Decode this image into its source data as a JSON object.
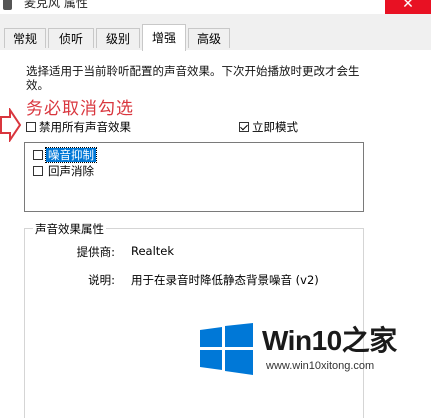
{
  "window": {
    "title": "麦克风 属性",
    "close_glyph": "✕"
  },
  "tabs": [
    {
      "label": "常规",
      "active": false
    },
    {
      "label": "侦听",
      "active": false
    },
    {
      "label": "级别",
      "active": false
    },
    {
      "label": "增强",
      "active": true
    },
    {
      "label": "高级",
      "active": false
    }
  ],
  "enhancements": {
    "description": "选择适用于当前聆听配置的声音效果。下次开始播放时更改才会生效。",
    "annotation": "务必取消勾选",
    "disable_all": {
      "label": "禁用所有声音效果",
      "checked": false
    },
    "immediate_mode": {
      "label": "立即模式",
      "checked": true
    },
    "effects": [
      {
        "label": "噪音抑制",
        "checked": false,
        "selected": true
      },
      {
        "label": "回声消除",
        "checked": false,
        "selected": false
      }
    ],
    "properties": {
      "title": "声音效果属性",
      "provider_label": "提供商:",
      "provider_value": "Realtek",
      "description_label": "说明:",
      "description_value": "用于在录音时降低静态背景噪音 (v2)"
    }
  },
  "watermark": {
    "brand_prefix": "Win10",
    "brand_suffix": "之家",
    "url": "www.win10xitong.com"
  },
  "colors": {
    "annotation": "#d9363e",
    "selection": "#0078d7",
    "close_button": "#e81123",
    "logo": "#0078d7"
  }
}
